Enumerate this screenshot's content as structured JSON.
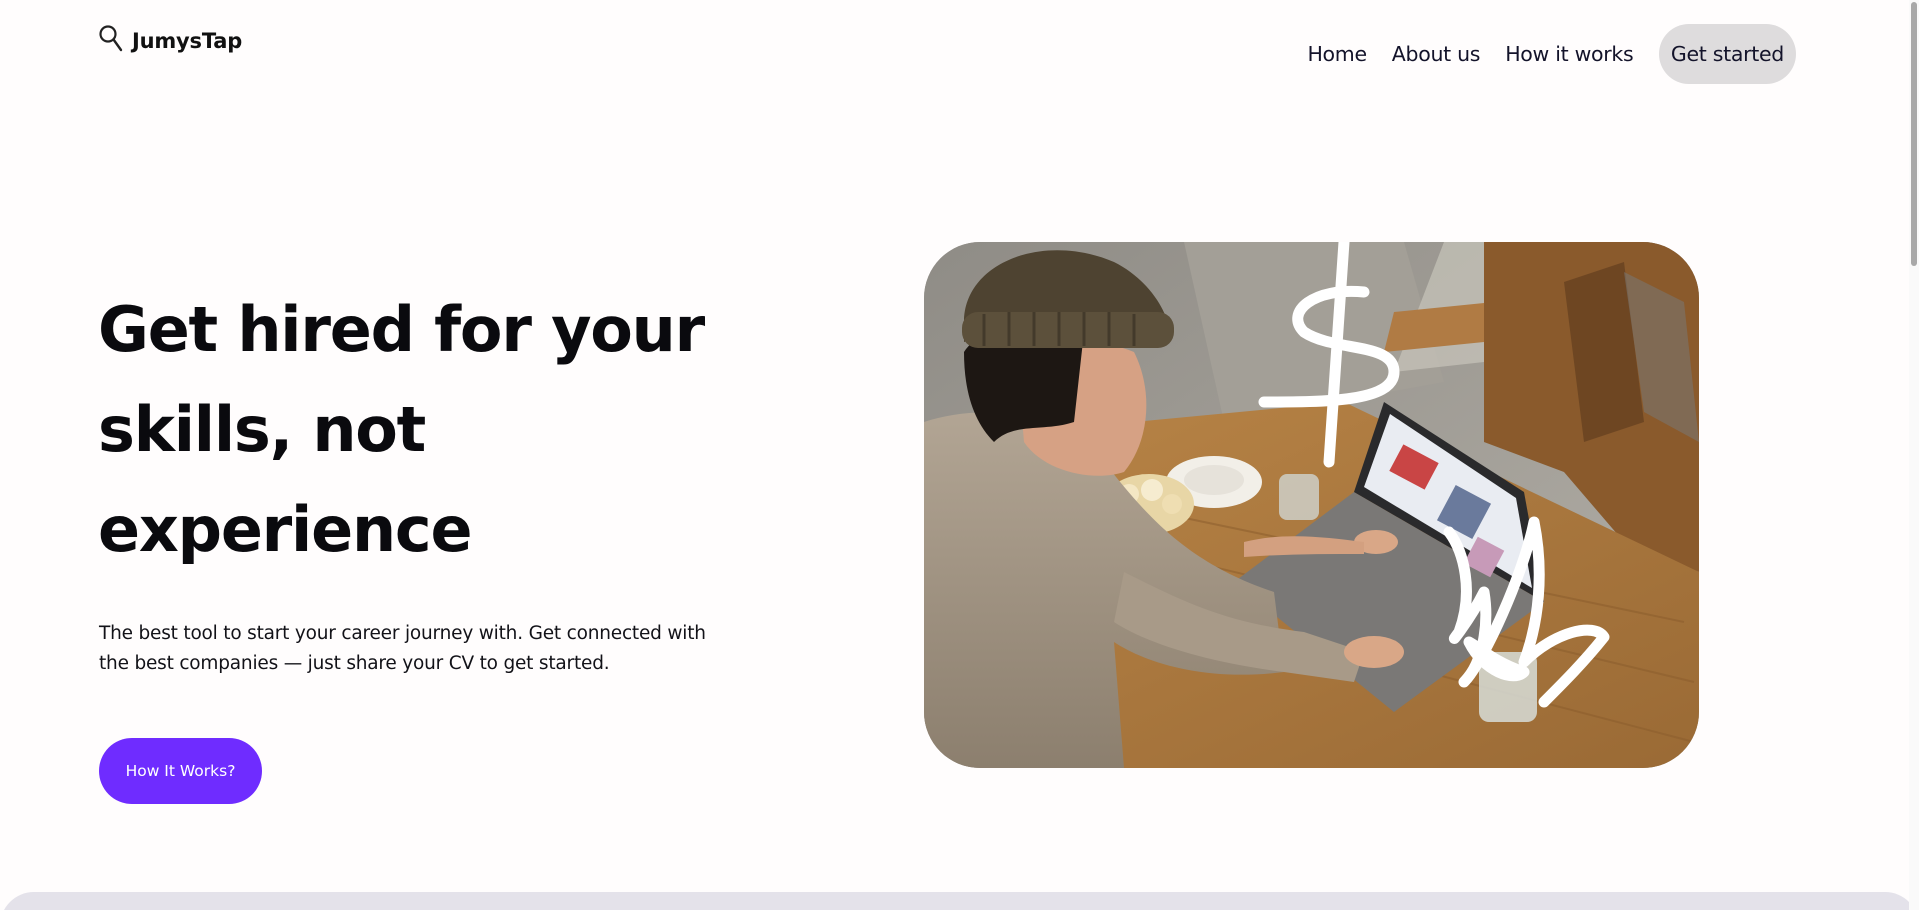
{
  "header": {
    "logo_text": "JumysTap",
    "logo_icon": "magnifier-icon",
    "nav": [
      {
        "label": "Home"
      },
      {
        "label": "About us"
      },
      {
        "label": "How it works"
      }
    ],
    "cta_label": "Get started"
  },
  "hero": {
    "title_lines": [
      "Get hired for your",
      "skills, not",
      "experience"
    ],
    "subtitle_lines": [
      "The best tool to start your career journey with. Get connected with",
      "the best companies — just share your CV to get started."
    ],
    "button_label": "How It Works?",
    "image": {
      "subject": "photo-woman-in-beanie-using-laptop-at-cafe-table"
    }
  },
  "colors": {
    "accent": "#6f2cff",
    "nav_cta_bg": "#dedcdd",
    "text": "#0a0a0e",
    "bottom_band": "#e4e2ea"
  }
}
